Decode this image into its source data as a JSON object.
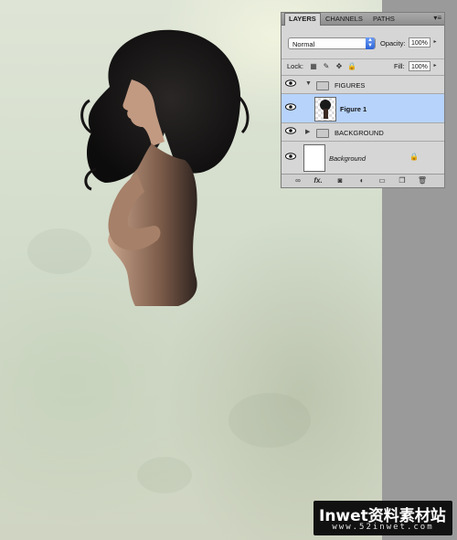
{
  "canvas": {
    "background_accent": "#dfe5d6"
  },
  "layers_panel": {
    "tabs": [
      "LAYERS",
      "CHANNELS",
      "PATHS"
    ],
    "active_tab": "LAYERS",
    "blend_mode": "Normal",
    "opacity_label": "Opacity:",
    "opacity_value": "100%",
    "lock_label": "Lock:",
    "fill_label": "Fill:",
    "fill_value": "100%",
    "layers": [
      {
        "name": "FIGURES",
        "type": "group",
        "expanded": true,
        "visible": true
      },
      {
        "name": "Figure 1",
        "type": "layer",
        "selected": true,
        "visible": true
      },
      {
        "name": "BACKGROUND",
        "type": "group",
        "expanded": false,
        "visible": true
      },
      {
        "name": "Background",
        "type": "background",
        "locked": true,
        "visible": true
      }
    ],
    "selected_color": "#b7d3fb",
    "footer_icons": [
      "link-icon",
      "fx-icon",
      "mask-icon",
      "adjustment-icon",
      "new-group-icon",
      "new-layer-icon",
      "trash-icon"
    ],
    "fx_label": "fx."
  },
  "watermark": {
    "title": "Inwet资料素材站",
    "url": "www.52inwet.com"
  }
}
